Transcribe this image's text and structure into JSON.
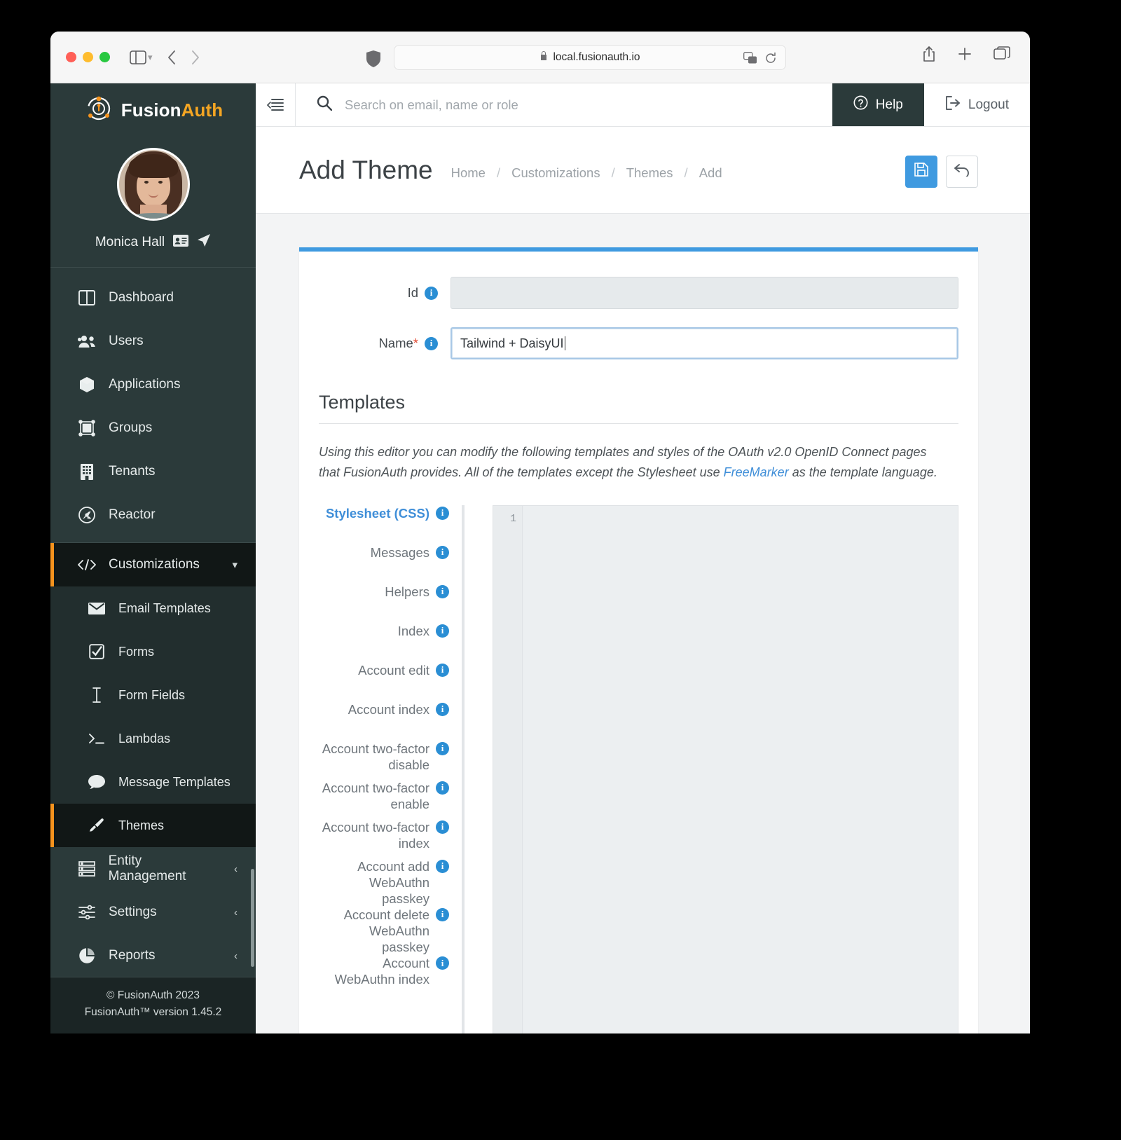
{
  "browser": {
    "url": "local.fusionauth.io",
    "lock_icon": "lock-icon",
    "shield_icon": "shield-icon",
    "translate_icon": "translate-icon",
    "reload_icon": "reload-icon",
    "back_icon": "back-arrow-icon",
    "forward_icon": "forward-arrow-icon",
    "sidebar_icon": "sidebar-toggle-icon",
    "share_icon": "share-icon",
    "new_tab_icon": "plus-icon",
    "tabs_icon": "tab-overview-icon"
  },
  "brand": {
    "name_first": "Fusion",
    "name_second": "Auth",
    "logo_icon": "fusionauth-logo-icon"
  },
  "profile": {
    "name": "Monica Hall",
    "badge_icon": "id-card-icon",
    "location_icon": "navigation-arrow-icon"
  },
  "topbar": {
    "collapse_icon": "collapse-menu-icon",
    "search_icon": "search-icon",
    "search_placeholder": "Search on email, name or role",
    "help_label": "Help",
    "help_icon": "question-circle-icon",
    "logout_label": "Logout",
    "logout_icon": "logout-icon"
  },
  "page": {
    "title": "Add Theme",
    "breadcrumbs": [
      "Home",
      "Customizations",
      "Themes",
      "Add"
    ],
    "breadcrumb_separator": "/",
    "save_icon": "save-floppy-icon",
    "back_icon": "undo-arrow-icon"
  },
  "form": {
    "id_label": "Id",
    "id_value": "",
    "name_label": "Name",
    "name_required_mark": "*",
    "name_value": "Tailwind + DaisyUI",
    "info_icon": "info-icon"
  },
  "templates": {
    "section_title": "Templates",
    "description_part1": "Using this editor you can modify the following templates and styles of the OAuth v2.0 OpenID Connect pages that FusionAuth provides. All of the templates except the Stylesheet use ",
    "description_link": "FreeMarker",
    "description_part2": " as the template language.",
    "items": [
      {
        "label": "Stylesheet (CSS)",
        "active": true
      },
      {
        "label": "Messages",
        "active": false
      },
      {
        "label": "Helpers",
        "active": false
      },
      {
        "label": "Index",
        "active": false
      },
      {
        "label": "Account edit",
        "active": false
      },
      {
        "label": "Account index",
        "active": false
      },
      {
        "label": "Account two-factor disable",
        "active": false
      },
      {
        "label": "Account two-factor enable",
        "active": false
      },
      {
        "label": "Account two-factor index",
        "active": false
      },
      {
        "label": "Account add WebAuthn passkey",
        "active": false
      },
      {
        "label": "Account delete WebAuthn passkey",
        "active": false
      },
      {
        "label": "Account WebAuthn index",
        "active": false
      }
    ],
    "editor_line_number": "1",
    "editor_content": ""
  },
  "sidebar": {
    "items": [
      {
        "label": "Dashboard",
        "icon": "dashboard-icon",
        "state": "normal"
      },
      {
        "label": "Users",
        "icon": "users-icon",
        "state": "normal"
      },
      {
        "label": "Applications",
        "icon": "applications-cube-icon",
        "state": "normal"
      },
      {
        "label": "Groups",
        "icon": "groups-icon",
        "state": "normal"
      },
      {
        "label": "Tenants",
        "icon": "tenants-building-icon",
        "state": "normal"
      },
      {
        "label": "Reactor",
        "icon": "reactor-icon",
        "state": "normal"
      }
    ],
    "customizations": {
      "label": "Customizations",
      "icon": "code-brackets-icon",
      "chevron": "chevron-down-icon"
    },
    "sub_items": [
      {
        "label": "Email Templates",
        "icon": "envelope-icon",
        "active": false
      },
      {
        "label": "Forms",
        "icon": "checkbox-icon",
        "active": false
      },
      {
        "label": "Form Fields",
        "icon": "text-cursor-icon",
        "active": false
      },
      {
        "label": "Lambdas",
        "icon": "terminal-icon",
        "active": false
      },
      {
        "label": "Message Templates",
        "icon": "chat-bubble-icon",
        "active": false
      },
      {
        "label": "Themes",
        "icon": "paintbrush-icon",
        "active": true
      }
    ],
    "bottom_items": [
      {
        "label": "Entity Management",
        "icon": "server-stack-icon",
        "chevron": "chevron-left-icon"
      },
      {
        "label": "Settings",
        "icon": "sliders-icon",
        "chevron": "chevron-left-icon"
      },
      {
        "label": "Reports",
        "icon": "pie-chart-icon",
        "chevron": "chevron-left-icon"
      }
    ],
    "footer_line1": "© FusionAuth 2023",
    "footer_line2": "FusionAuth™ version 1.45.2"
  },
  "colors": {
    "nav_bg": "#2b3a3a",
    "accent_orange": "#f5931e",
    "primary_blue": "#3f9ae0",
    "link_blue": "#3f8ed8",
    "required_red": "#e04a32"
  }
}
